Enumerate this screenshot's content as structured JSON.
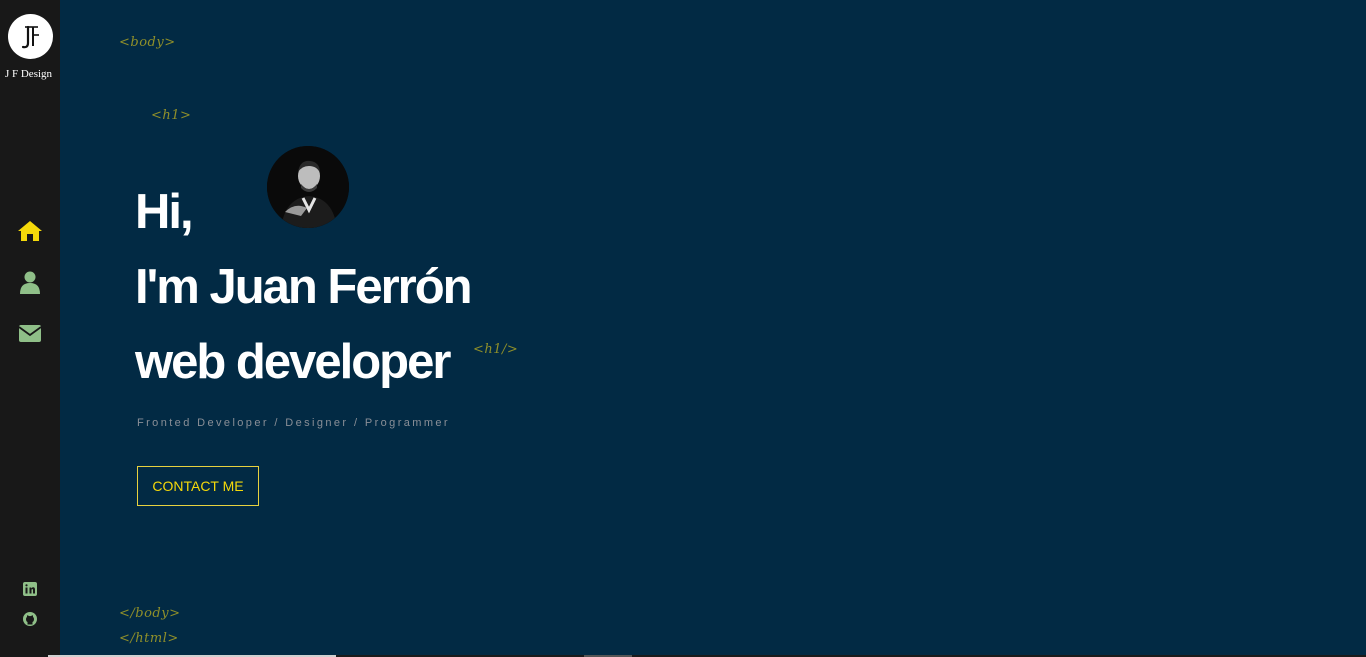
{
  "sidebar": {
    "logo_label": "J F Design",
    "logo_icon": "jf-monogram-icon",
    "nav": [
      {
        "name": "home",
        "icon": "home-icon",
        "color": "#f5d90a"
      },
      {
        "name": "about",
        "icon": "user-icon",
        "color": "#8fbf88"
      },
      {
        "name": "contact",
        "icon": "envelope-icon",
        "color": "#8fbf88"
      }
    ],
    "social": [
      {
        "name": "linkedin",
        "icon": "linkedin-icon"
      },
      {
        "name": "github",
        "icon": "github-icon"
      }
    ]
  },
  "tags": {
    "body_open": "<body>",
    "h1_open": "<h1>",
    "h1_close": "<h1/>",
    "body_close": "</body>",
    "html_close": "</html>"
  },
  "hero": {
    "line1": "Hi,",
    "line2": "I'm Juan Ferrón",
    "line3": "web developer",
    "subtitle": "Fronted Developer / Designer / Programmer",
    "cta_label": "CONTACT ME"
  },
  "colors": {
    "background": "#022a44",
    "sidebar": "#181818",
    "accent": "#f5d90a",
    "tag": "#8f8f2a",
    "icon_green": "#8fbf88"
  }
}
